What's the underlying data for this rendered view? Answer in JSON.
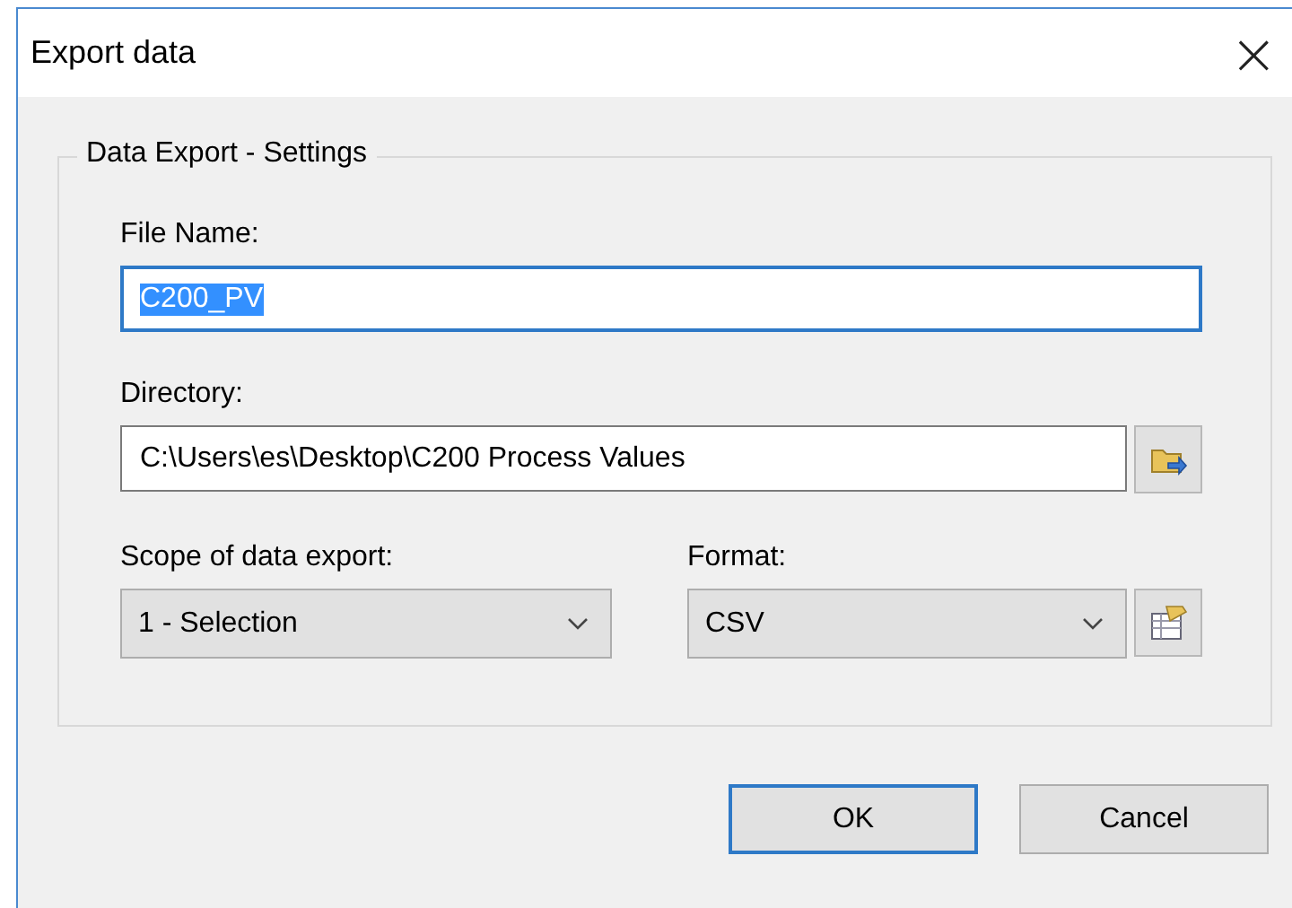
{
  "window": {
    "title": "Export data",
    "close": "×"
  },
  "group": {
    "title": "Data Export - Settings"
  },
  "file_name": {
    "label": "File Name:",
    "value": "C200_PV",
    "text_selected": true,
    "focused": true
  },
  "directory": {
    "label": "Directory:",
    "value": "C:\\Users\\es\\Desktop\\C200 Process Values"
  },
  "scope": {
    "label": "Scope of data export:",
    "value": "1 - Selection"
  },
  "format": {
    "label": "Format:",
    "value": "CSV"
  },
  "buttons": [
    {
      "label": "OK",
      "focused": true
    },
    {
      "label": "Cancel",
      "focused": false
    }
  ]
}
